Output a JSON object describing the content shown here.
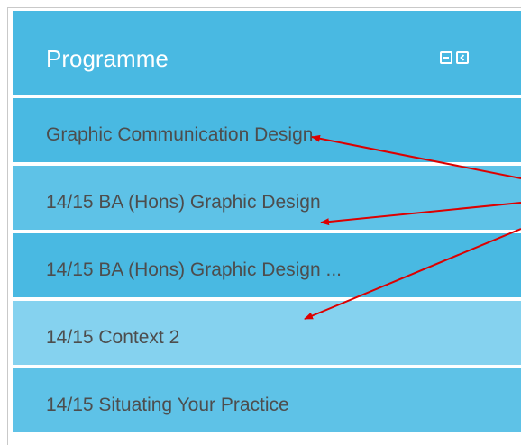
{
  "block": {
    "title": "Programme",
    "controls": [
      {
        "icon": "minimize-icon"
      },
      {
        "icon": "dock-icon"
      }
    ]
  },
  "nav_items": [
    {
      "label": "Graphic Communication Design",
      "shade": "#49b9e2"
    },
    {
      "label": "14/15 BA (Hons) Graphic Design",
      "shade": "#5ec2e7"
    },
    {
      "label": "14/15 BA (Hons) Graphic Design ...",
      "shade": "#49b9e2"
    },
    {
      "label": "14/15 Context 2",
      "shade": "#85d2ef"
    },
    {
      "label": "14/15 Situating Your Practice",
      "shade": "#5ec2e7"
    }
  ],
  "colors": {
    "header": "#49b9e2",
    "title_text": "#ffffff",
    "item_text": "#4d4d4d",
    "annotation_arrow": "#dd0000"
  }
}
